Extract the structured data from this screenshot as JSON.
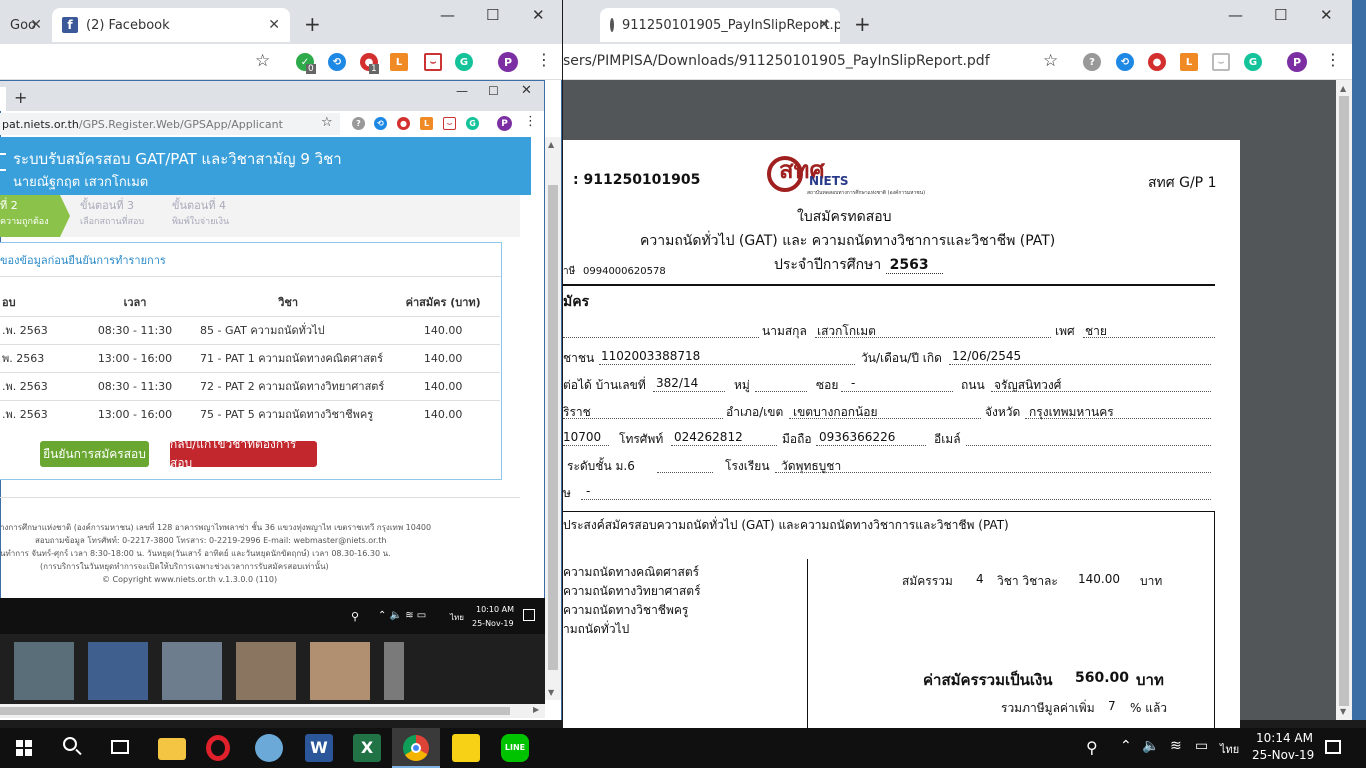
{
  "left_browser": {
    "tabs": [
      {
        "label": "Goo"
      },
      {
        "label": "(2) Facebook"
      }
    ],
    "new_tab_label": "+",
    "extension_badges": {
      "green": "0",
      "red": "1"
    },
    "profile_initial": "P"
  },
  "inner_browser": {
    "new_tab_label": "+",
    "url_host": "pat.niets.or.th",
    "url_path": "/GPS.Register.Web/GPSApp/Applicant",
    "header_title": "ระบบรับสมัครสอบ GAT/PAT และวิชาสามัญ 9 วิชา",
    "header_user": "นายณัฐกฤต เสวกโกเมต",
    "steps": [
      {
        "title": "ที่ 2",
        "sub": "ความถูกต้อง"
      },
      {
        "title": "ขั้นตอนที่ 3",
        "sub": "เลือกสถานที่สอบ"
      },
      {
        "title": "ขั้นตอนที่ 4",
        "sub": "พิมพ์ใบจ่ายเงิน"
      }
    ],
    "panel_title": "ของข้อมูลก่อนยืนยันการทำรายการ",
    "table_headers": [
      "อบ",
      "เวลา",
      "วิชา",
      "ค่าสมัคร (บาท)"
    ],
    "table_rows": [
      [
        ".พ. 2563",
        "08:30 - 11:30",
        "85 - GAT ความถนัดทั่วไป",
        "140.00"
      ],
      [
        "พ. 2563",
        "13:00 - 16:00",
        "71 - PAT 1 ความถนัดทางคณิตศาสตร์",
        "140.00"
      ],
      [
        ".พ. 2563",
        "08:30 - 11:30",
        "72 - PAT 2 ความถนัดทางวิทยาศาสตร์",
        "140.00"
      ],
      [
        ".พ. 2563",
        "13:00 - 16:00",
        "75 - PAT 5 ความถนัดทางวิชาชีพครู",
        "140.00"
      ]
    ],
    "confirm_button": "ยืนยันการสมัครสอบ",
    "back_button": "กลับ/แก้ไขวิชาที่ต้องการสอบ",
    "footer_lines": [
      "างการศึกษาแห่งชาติ (องค์การมหาชน) เลขที่ 128 อาคารพญาไทพลาซ่า ชั้น 36 แขวงทุ่งพญาไท เขตราชเทวี กรุงเทพ 10400",
      "สอบถามข้อมูล โทรศัพท์: 0-2217-3800 โทรสาร: 0-2219-2996 E-mail: webmaster@niets.or.th",
      "นทำการ จันทร์-ศุกร์ เวลา 8:30-18:00 น. วันหยุด(วันเสาร์ อาทิตย์ และวันหยุดนักขัตฤกษ์) เวลา 08.30-16.30 น.",
      "(การบริการในวันหยุดทำการจะเปิดให้บริการเฉพาะช่วงเวลาการรับสมัครสอบเท่านั้น)",
      "© Copyright www.niets.or.th v.1.3.0.0 (110)"
    ]
  },
  "mini_taskbar": {
    "time": "10:10 AM",
    "date": "25-Nov-19",
    "lang": "ไทย"
  },
  "right_browser": {
    "tab_label": "911250101905_PayInSlipReport.pdf",
    "new_tab_label": "+",
    "url": "sers/PIMPISA/Downloads/911250101905_PayInSlipReport.pdf",
    "profile_initial": "P"
  },
  "pdf": {
    "ref_number": "911250101905",
    "logo_text": "สทศ",
    "logo_sub": "NIETS",
    "logo_caption": "สถาบันทดสอบทางการศึกษาแห่งชาติ (องค์การมหาชน)",
    "form_code": "สทศ G/P 1",
    "title1": "ใบสมัครทดสอบ",
    "title2": "ความถนัดทั่วไป (GAT) และ ความถนัดทางวิชาการและวิชาชีพ (PAT)",
    "title3_label": "ประจำปีการศึกษา",
    "title3_year": "2563",
    "tax_label": "าษี",
    "tax_id": "0994000620578",
    "section_applicant": "มัคร",
    "surname_label": "นามสกุล",
    "surname": "เสวกโกเมต",
    "sex_label": "เพศ",
    "sex": "ชาย",
    "id_label": "ชาชน",
    "id_number": "1102003388718",
    "dob_label": "วัน/เดือน/ปี เกิด",
    "dob": "12/06/2545",
    "addr_label": "ต่อได้ บ้านเลขที่",
    "house_no": "382/14",
    "moo_label": "หมู่",
    "soi_label": "ซอย",
    "soi": "-",
    "road_label": "ถนน",
    "road": "จรัญสนิทวงศ์",
    "subdistrict": "ริราช",
    "district_label": "อำเภอ/เขต",
    "district": "เขตบางกอกน้อย",
    "province_label": "จังหวัด",
    "province": "กรุงเทพมหานคร",
    "postcode": "10700",
    "phone_label": "โทรศัพท์",
    "phone": "024262812",
    "mobile_label": "มือถือ",
    "mobile": "0936366226",
    "email_label": "อีเมล์",
    "edu_label": "ระดับชั้น ม.6",
    "school_label": "โรงเรียน",
    "school": "วัดพุทธบูชา",
    "other_label": "ษ",
    "other": "-",
    "purpose": "ประสงค์สมัครสอบความถนัดทั่วไป (GAT) และความถนัดทางวิชาการและวิชาชีพ (PAT)",
    "subjects": [
      "ความถนัดทางคณิตศาสตร์",
      "ความถนัดทางวิทยาศาสตร์",
      "ความถนัดทางวิชาชีพครู",
      "ามถนัดทั่วไป"
    ],
    "total_label": "สมัครรวม",
    "total_count": "4",
    "per_subject_label": "วิชา วิชาละ",
    "per_subject_fee": "140.00",
    "baht": "บาท",
    "grand_label": "ค่าสมัครรวมเป็นเงิน",
    "grand_total": "560.00",
    "vat_label": "รวมภาษีมูลค่าเพิ่ม",
    "vat_rate": "7",
    "vat_suffix": "% แล้ว"
  },
  "taskbar": {
    "time": "10:14 AM",
    "date": "25-Nov-19",
    "lang": "ไทย"
  }
}
